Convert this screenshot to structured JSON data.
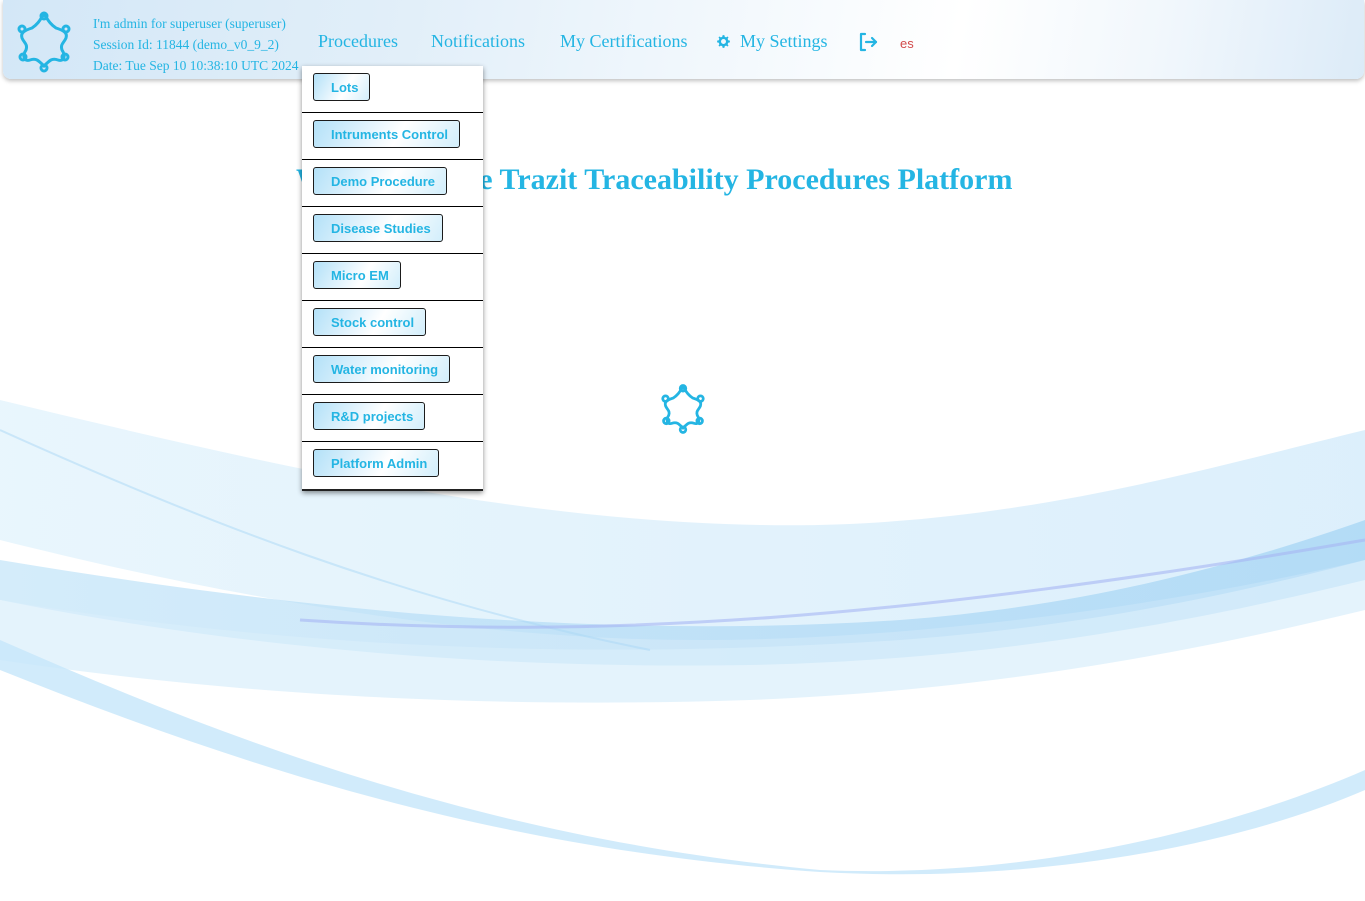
{
  "session": {
    "user_line": "I'm admin for superuser (superuser)",
    "session_line": "Session Id: 11844 (demo_v0_9_2)",
    "date_line": "Date: Tue Sep 10 10:38:10 UTC 2024"
  },
  "nav": {
    "procedures": "Procedures",
    "notifications": "Notifications",
    "certifications": "My Certifications",
    "settings": "My Settings",
    "language": "es"
  },
  "icons": {
    "logo": "trazit-logo-icon",
    "settings": "gear-icon",
    "logout": "logout-icon",
    "spinner": "trazit-spinner-icon"
  },
  "procedures_menu": [
    "Lots",
    "Intruments Control",
    "Demo Procedure",
    "Disease Studies",
    "Micro EM",
    "Stock control",
    "Water monitoring",
    "R&D projects",
    "Platform Admin"
  ],
  "main": {
    "welcome_title": "Welcome to the Trazit Traceability Procedures Platform"
  },
  "colors": {
    "accent": "#24b5e3",
    "language": "#d24b4b",
    "wave": "#a8d8f5"
  }
}
